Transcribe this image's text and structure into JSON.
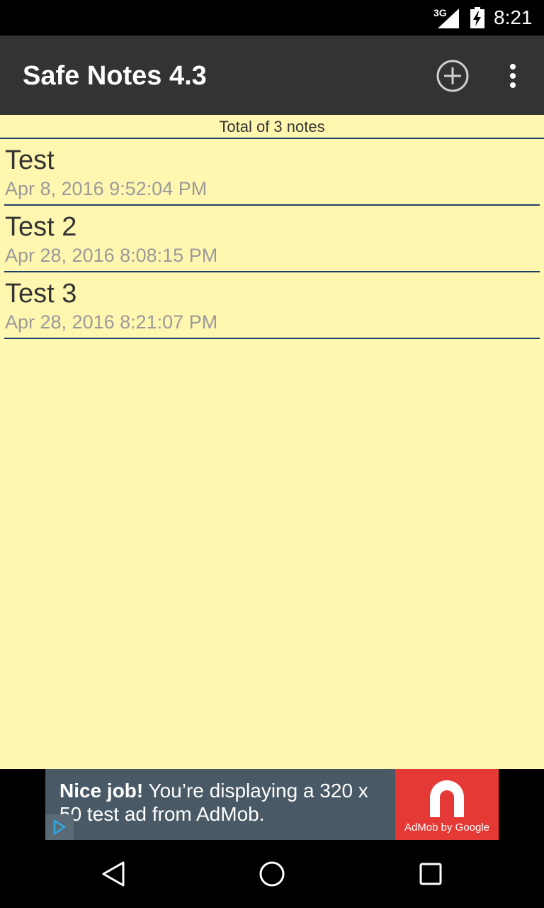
{
  "status_bar": {
    "network": "3G",
    "time": "8:21"
  },
  "app_bar": {
    "title": "Safe Notes 4.3"
  },
  "list": {
    "summary": "Total of 3 notes",
    "notes": [
      {
        "title": "Test",
        "date": "Apr 8, 2016 9:52:04 PM"
      },
      {
        "title": "Test 2",
        "date": "Apr 28, 2016 8:08:15 PM"
      },
      {
        "title": "Test 3",
        "date": "Apr 28, 2016 8:21:07 PM"
      }
    ]
  },
  "ad": {
    "headline": "Nice job!",
    "body": " You’re displaying a 320 x 50 test ad from AdMob.",
    "brand": "AdMob by Google"
  },
  "colors": {
    "status_bar": "#000000",
    "app_bar": "#333333",
    "content_bg": "#FFF7B0",
    "divider": "#1E3F66",
    "ad_bg": "#4A5966",
    "ad_logo": "#E53935"
  }
}
